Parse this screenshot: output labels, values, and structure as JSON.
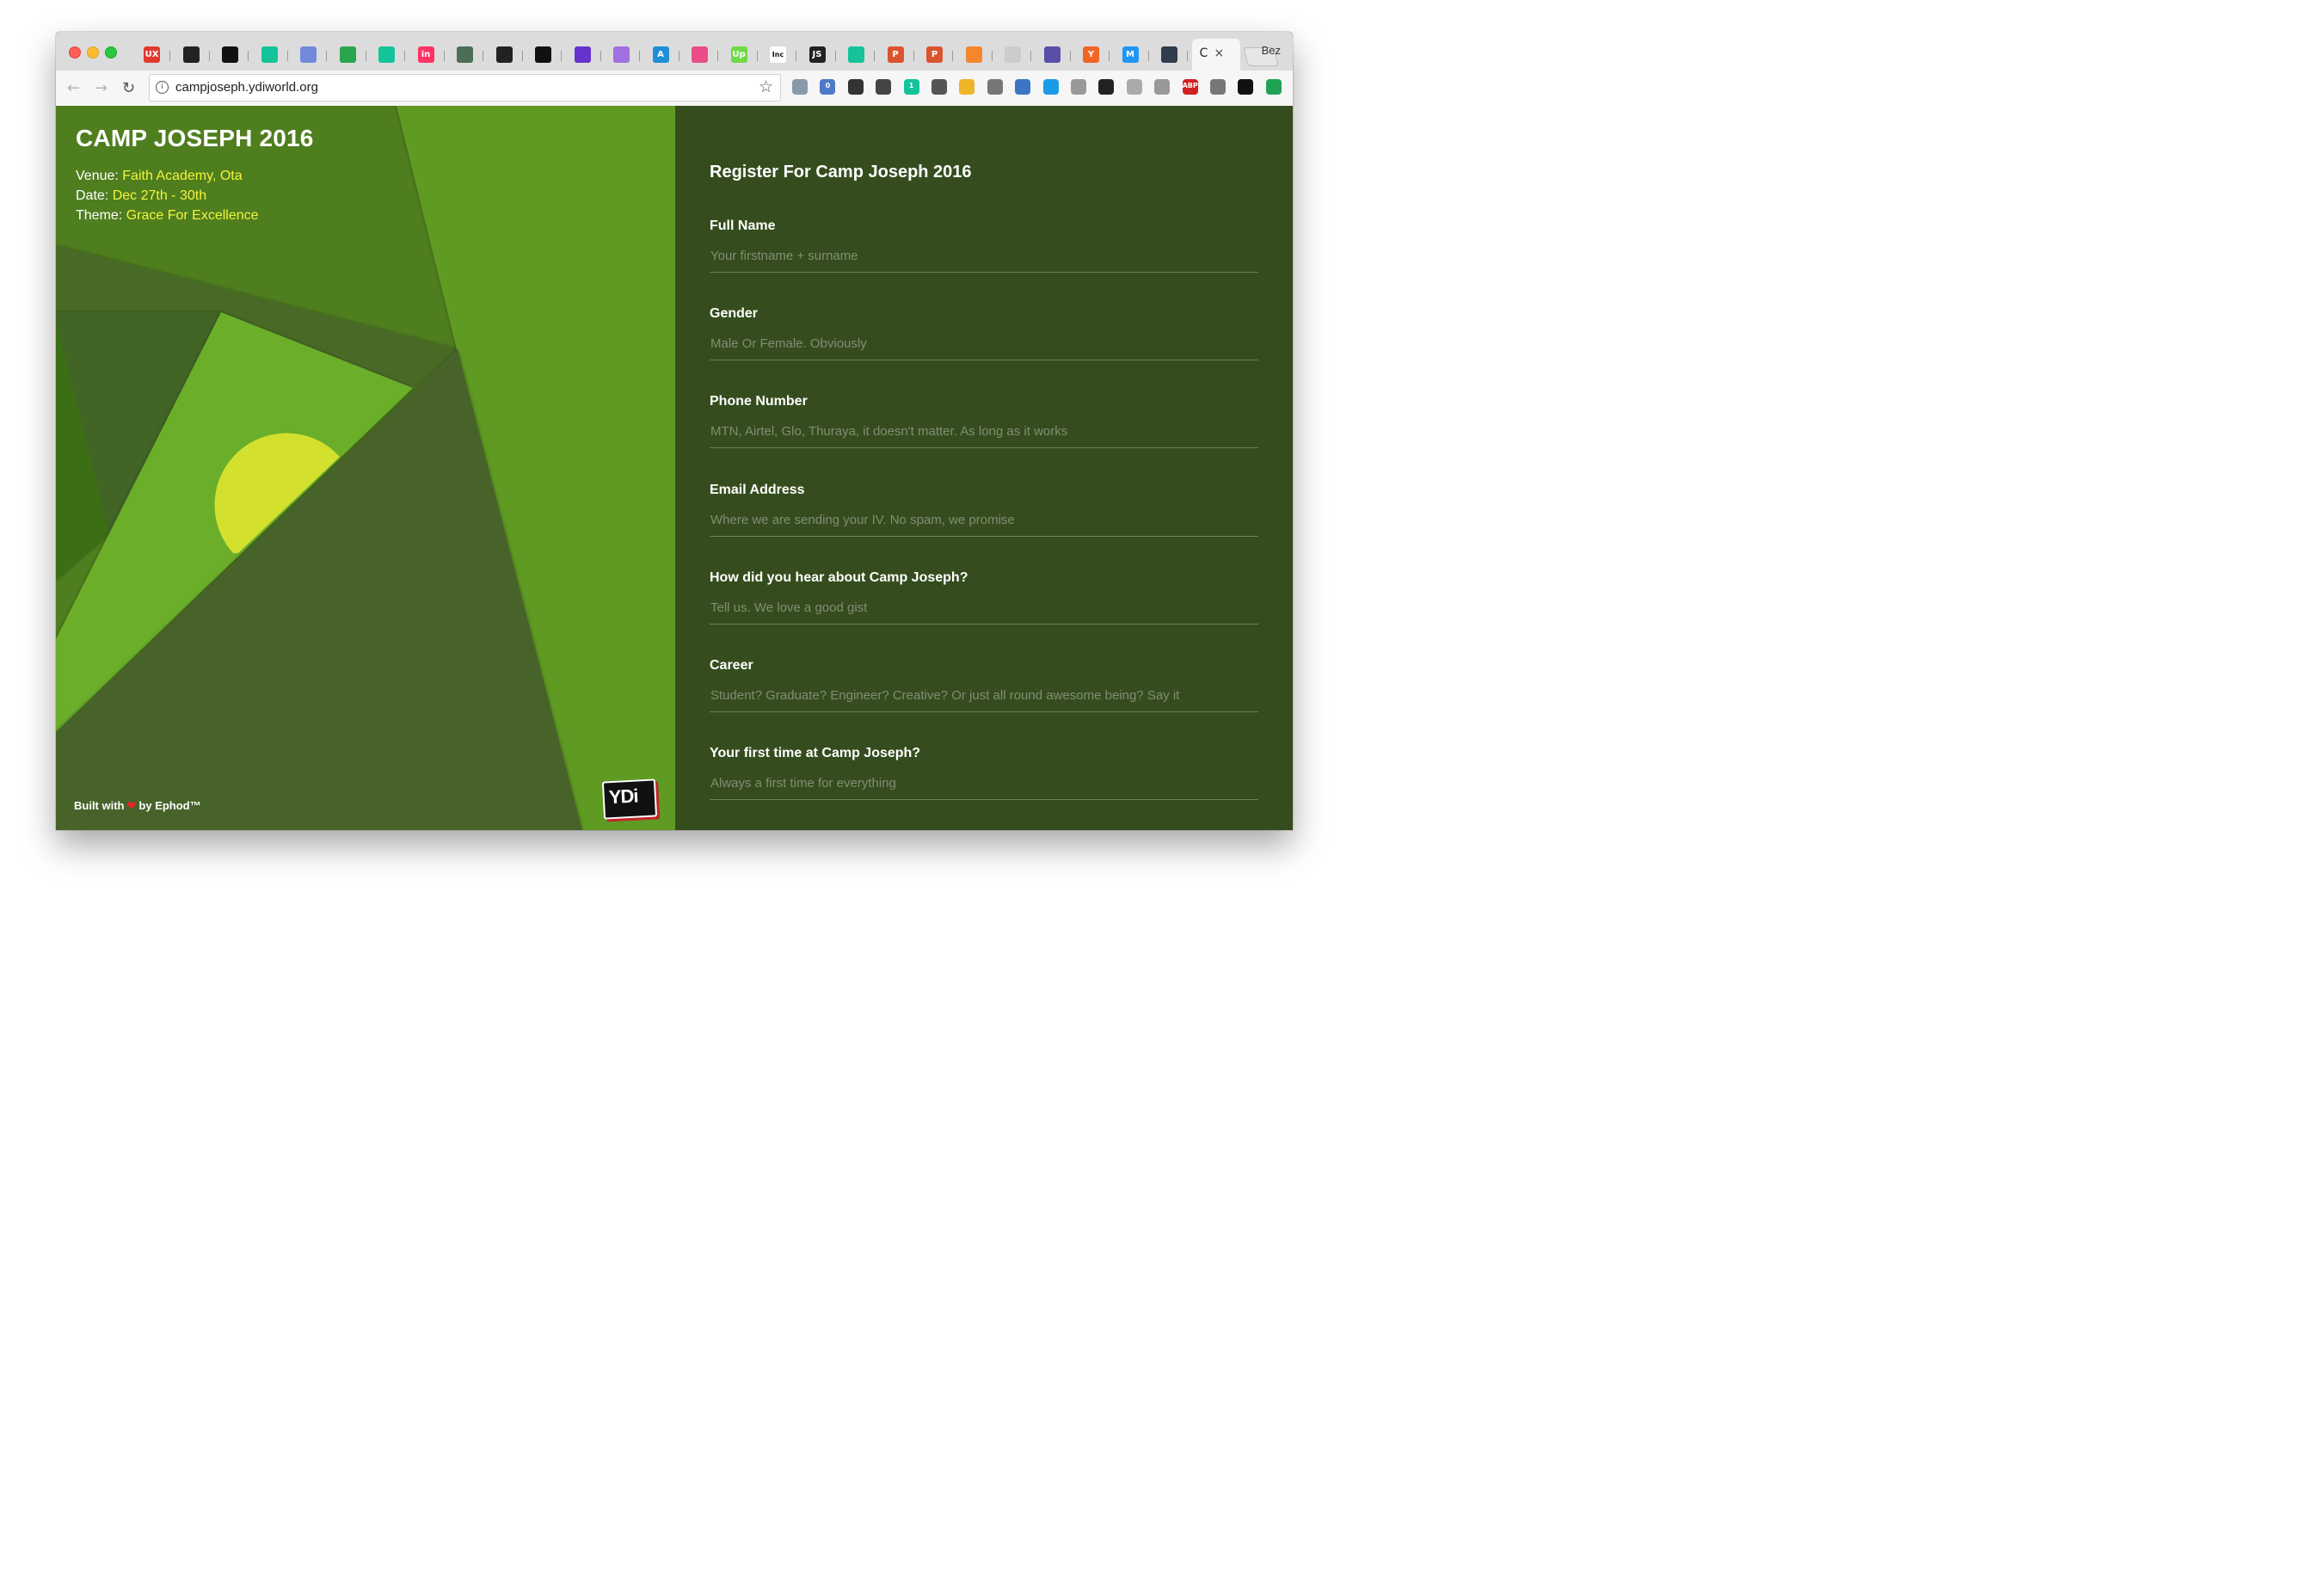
{
  "browser": {
    "profile_name": "Bez",
    "url": "campjoseph.ydiworld.org",
    "active_tab_label": "C",
    "close_glyph": "×",
    "tabs": [
      {
        "icon": "ux-icon",
        "text": "UX",
        "color": "#e03a2f"
      },
      {
        "icon": "shark-icon",
        "text": "",
        "color": "#222222"
      },
      {
        "icon": "square-icon",
        "text": "",
        "color": "#111111"
      },
      {
        "icon": "medium-icon",
        "text": "",
        "color": "#15c39a"
      },
      {
        "icon": "discord-icon",
        "text": "",
        "color": "#7289da"
      },
      {
        "icon": "dollar-icon",
        "text": "",
        "color": "#2aa64e"
      },
      {
        "icon": "medium-icon",
        "text": "",
        "color": "#15c39a"
      },
      {
        "icon": "invision-icon",
        "text": "in",
        "color": "#ff3366"
      },
      {
        "icon": "hand-icon",
        "text": "",
        "color": "#4c6e54"
      },
      {
        "icon": "flag-icon",
        "text": "",
        "color": "#222222"
      },
      {
        "icon": "circle-icon",
        "text": "",
        "color": "#111111"
      },
      {
        "icon": "star-icon",
        "text": "",
        "color": "#6633cc"
      },
      {
        "icon": "rings-icon",
        "text": "",
        "color": "#a070e0"
      },
      {
        "icon": "a-icon",
        "text": "A",
        "color": "#1e8fd6"
      },
      {
        "icon": "dribbble-icon",
        "text": "",
        "color": "#ea4c89"
      },
      {
        "icon": "upwork-icon",
        "text": "Up",
        "color": "#6fda44"
      },
      {
        "icon": "inc-icon",
        "text": "Inc",
        "color": "#ffffff"
      },
      {
        "icon": "js-icon",
        "text": "JS",
        "color": "#222222"
      },
      {
        "icon": "medium-icon",
        "text": "",
        "color": "#15c39a"
      },
      {
        "icon": "producthunt-icon",
        "text": "P",
        "color": "#da552f"
      },
      {
        "icon": "producthunt-icon",
        "text": "P",
        "color": "#da552f"
      },
      {
        "icon": "orange-circle-icon",
        "text": "",
        "color": "#f5862c"
      },
      {
        "icon": "document-icon",
        "text": "",
        "color": "#cccccc"
      },
      {
        "icon": "shield-icon",
        "text": "",
        "color": "#5a4fa8"
      },
      {
        "icon": "ycombinator-icon",
        "text": "Y",
        "color": "#f26522"
      },
      {
        "icon": "gmail-icon",
        "text": "M",
        "color": "#2196f3"
      },
      {
        "icon": "download-icon",
        "text": "",
        "color": "#2f3d4d"
      }
    ],
    "extensions": [
      "magnifier-icon",
      "ghost-icon",
      "evernote-icon",
      "camera-icon",
      "grammarly-icon",
      "pocket-icon",
      "folder-icon",
      "s-icon",
      "eyedropper-icon",
      "at-icon",
      "globe-icon",
      "contrast-icon",
      "rocket-icon",
      "grid-icon",
      "adblock-icon",
      "film-icon",
      "bird-icon",
      "upload-icon"
    ],
    "extension_colors": [
      "#8899aa",
      "#4f7ac7",
      "#333333",
      "#444444",
      "#15c39a",
      "#555555",
      "#f0b429",
      "#777777",
      "#3c75c4",
      "#1a9be8",
      "#999999",
      "#222222",
      "#aaaaaa",
      "#999999",
      "#d32020",
      "#777777",
      "#111111",
      "#1ea355"
    ],
    "extension_badges": {
      "ghost-icon": "0",
      "grammarly-icon": "1",
      "adblock-icon": "ABP"
    }
  },
  "event": {
    "title": "CAMP JOSEPH 2016",
    "venue_label": "Venue: ",
    "venue_value": "Faith Academy, Ota",
    "date_label": "Date: ",
    "date_value": "Dec 27th - 30th",
    "theme_label": "Theme: ",
    "theme_value": "Grace For Excellence",
    "footer_prefix": "Built with",
    "footer_suffix": "by Ephod™",
    "logo_text": "YDi"
  },
  "form": {
    "title": "Register For Camp Joseph 2016",
    "fields": [
      {
        "label": "Full Name",
        "placeholder": "Your firstname + surname"
      },
      {
        "label": "Gender",
        "placeholder": "Male Or Female. Obviously"
      },
      {
        "label": "Phone Number",
        "placeholder": "MTN, Airtel, Glo, Thuraya, it doesn't matter. As long as it works"
      },
      {
        "label": "Email Address",
        "placeholder": "Where we are sending your IV. No spam, we promise"
      },
      {
        "label": "How did you hear about Camp Joseph?",
        "placeholder": "Tell us. We love a good gist"
      },
      {
        "label": "Career",
        "placeholder": "Student? Graduate? Engineer? Creative? Or just all round awesome being? Say it"
      },
      {
        "label": "Your first time at Camp Joseph?",
        "placeholder": "Always a first time for everything"
      }
    ]
  },
  "colors": {
    "accent_yellow": "#f3f53a",
    "form_bg": "#354d1e",
    "heart": "#e2262a"
  }
}
